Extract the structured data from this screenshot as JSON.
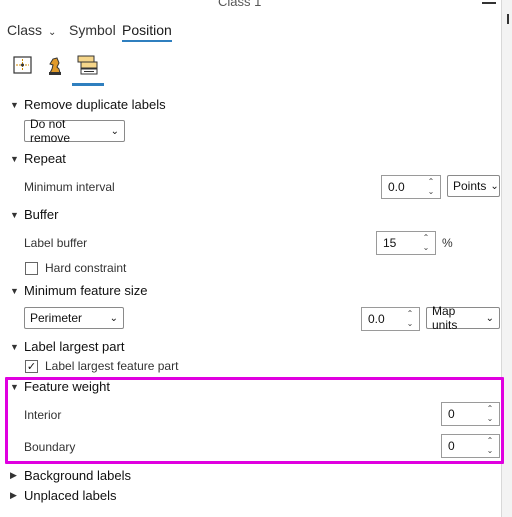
{
  "window": {
    "title": "Class 1"
  },
  "tabs": [
    {
      "label": "Class"
    },
    {
      "label": "Symbol"
    },
    {
      "label": "Position"
    }
  ],
  "sections": {
    "remove_duplicates": {
      "label": "Remove duplicate labels",
      "select_value": "Do not remove"
    },
    "repeat": {
      "label": "Repeat",
      "field_label": "Minimum interval",
      "value": "0.0",
      "unit": "Points"
    },
    "buffer": {
      "label": "Buffer",
      "field_label": "Label buffer",
      "value": "15",
      "unit": "%",
      "hard_constraint_label": "Hard constraint",
      "hard_constraint_checked": false
    },
    "min_feature_size": {
      "label": "Minimum feature size",
      "measure": "Perimeter",
      "value": "0.0",
      "unit": "Map units"
    },
    "label_largest": {
      "label": "Label largest part",
      "checkbox_label": "Label largest feature part",
      "checked": true
    },
    "feature_weight": {
      "label": "Feature weight",
      "interior_label": "Interior",
      "interior_value": "0",
      "boundary_label": "Boundary",
      "boundary_value": "0"
    },
    "background_labels": {
      "label": "Background labels"
    },
    "unplaced_labels": {
      "label": "Unplaced labels"
    }
  },
  "colors": {
    "accent": "#2f7fbf",
    "highlight": "#e000e0"
  }
}
